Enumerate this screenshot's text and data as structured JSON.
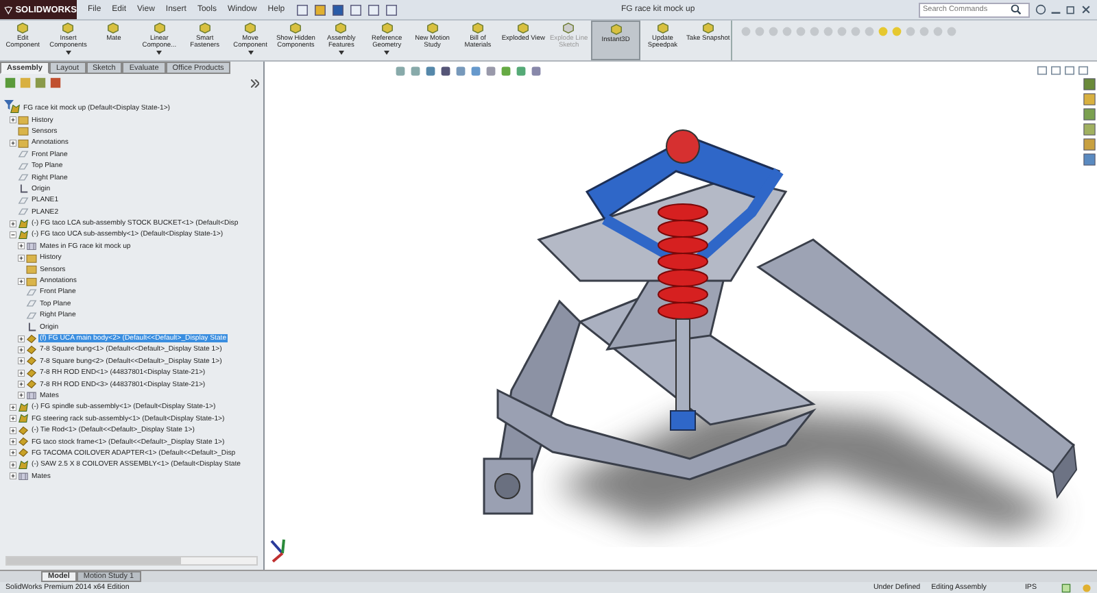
{
  "app": {
    "logo": "SOLIDWORKS",
    "menus": [
      "File",
      "Edit",
      "View",
      "Insert",
      "Tools",
      "Window",
      "Help"
    ],
    "title": "FG race kit mock up",
    "search": {
      "placeholder": "Search Commands"
    }
  },
  "commands": [
    {
      "label": "Edit Component",
      "menu": false,
      "disabled": false,
      "selected": false
    },
    {
      "label": "Insert Components",
      "menu": true,
      "disabled": false,
      "selected": false
    },
    {
      "label": "Mate",
      "menu": false,
      "disabled": false,
      "selected": false
    },
    {
      "label": "Linear Compone...",
      "menu": true,
      "disabled": false,
      "selected": false
    },
    {
      "label": "Smart Fasteners",
      "menu": false,
      "disabled": false,
      "selected": false
    },
    {
      "label": "Move Component",
      "menu": true,
      "disabled": false,
      "selected": false
    },
    {
      "label": "Show Hidden Components",
      "menu": false,
      "disabled": false,
      "selected": false
    },
    {
      "label": "Assembly Features",
      "menu": true,
      "disabled": false,
      "selected": false
    },
    {
      "label": "Reference Geometry",
      "menu": true,
      "disabled": false,
      "selected": false
    },
    {
      "label": "New Motion Study",
      "menu": false,
      "disabled": false,
      "selected": false
    },
    {
      "label": "Bill of Materials",
      "menu": false,
      "disabled": false,
      "selected": false
    },
    {
      "label": "Exploded View",
      "menu": false,
      "disabled": false,
      "selected": false
    },
    {
      "label": "Explode Line Sketch",
      "menu": false,
      "disabled": true,
      "selected": false
    },
    {
      "label": "Instant3D",
      "menu": false,
      "disabled": false,
      "selected": true
    },
    {
      "label": "Update Speedpak",
      "menu": false,
      "disabled": false,
      "selected": false
    },
    {
      "label": "Take Snapshot",
      "menu": false,
      "disabled": false,
      "selected": false
    }
  ],
  "tabs": [
    {
      "label": "Assembly",
      "selected": true
    },
    {
      "label": "Layout",
      "selected": false
    },
    {
      "label": "Sketch",
      "selected": false
    },
    {
      "label": "Evaluate",
      "selected": false
    },
    {
      "label": "Office Products",
      "selected": false
    }
  ],
  "tree": {
    "label": "FG race kit mock up  (Default<Display State-1>)",
    "kind": "assembly",
    "selected": false,
    "children": [
      {
        "label": "History",
        "kind": "folder",
        "expanded": false,
        "selected": false
      },
      {
        "label": "Sensors",
        "kind": "folder",
        "selected": false
      },
      {
        "label": "Annotations",
        "kind": "annotation",
        "expanded": false,
        "selected": false
      },
      {
        "label": "Front Plane",
        "kind": "plane",
        "selected": false
      },
      {
        "label": "Top Plane",
        "kind": "plane",
        "selected": false
      },
      {
        "label": "Right Plane",
        "kind": "plane",
        "selected": false
      },
      {
        "label": "Origin",
        "kind": "origin",
        "selected": false
      },
      {
        "label": "PLANE1",
        "kind": "plane",
        "selected": false
      },
      {
        "label": "PLANE2",
        "kind": "plane",
        "selected": false
      },
      {
        "label": "(-) FG taco LCA sub-assembly STOCK BUCKET<1> (Default<Disp",
        "kind": "assembly",
        "expanded": false,
        "selected": false
      },
      {
        "label": "(-) FG taco UCA sub-assembly<1> (Default<Display State-1>)",
        "kind": "assembly",
        "expanded": true,
        "selected": false,
        "children": [
          {
            "label": "Mates in FG race kit mock up",
            "kind": "mates",
            "expanded": false,
            "selected": false
          },
          {
            "label": "History",
            "kind": "folder",
            "expanded": false,
            "selected": false
          },
          {
            "label": "Sensors",
            "kind": "folder",
            "selected": false
          },
          {
            "label": "Annotations",
            "kind": "annotation",
            "expanded": false,
            "selected": false
          },
          {
            "label": "Front Plane",
            "kind": "plane",
            "selected": false
          },
          {
            "label": "Top Plane",
            "kind": "plane",
            "selected": false
          },
          {
            "label": "Right Plane",
            "kind": "plane",
            "selected": false
          },
          {
            "label": "Origin",
            "kind": "origin",
            "selected": false
          },
          {
            "label": "(f) FG UCA main body<2> (Default<<Default>_Display State",
            "kind": "part",
            "expanded": false,
            "selected": true
          },
          {
            "label": "7-8 Square bung<1> (Default<<Default>_Display State 1>)",
            "kind": "part",
            "expanded": false,
            "selected": false
          },
          {
            "label": "7-8 Square bung<2> (Default<<Default>_Display State 1>)",
            "kind": "part",
            "expanded": false,
            "selected": false
          },
          {
            "label": "7-8 RH ROD END<1> (44837801<Display State-21>)",
            "kind": "part",
            "expanded": false,
            "selected": false
          },
          {
            "label": "7-8 RH ROD END<3> (44837801<Display State-21>)",
            "kind": "part",
            "expanded": false,
            "selected": false
          },
          {
            "label": "Mates",
            "kind": "mates",
            "expanded": false,
            "selected": false
          }
        ]
      },
      {
        "label": "(-) FG spindle sub-assembly<1> (Default<Display State-1>)",
        "kind": "assembly",
        "expanded": false,
        "selected": false
      },
      {
        "label": "FG steering rack sub-assembly<1> (Default<Display State-1>)",
        "kind": "assembly",
        "expanded": false,
        "selected": false
      },
      {
        "label": "(-) Tie Rod<1> (Default<<Default>_Display State 1>)",
        "kind": "part",
        "expanded": false,
        "selected": false
      },
      {
        "label": "FG taco stock frame<1> (Default<<Default>_Display State 1>)",
        "kind": "part",
        "expanded": false,
        "selected": false
      },
      {
        "label": "FG TACOMA COILOVER ADAPTER<1> (Default<<Default>_Disp",
        "kind": "part",
        "expanded": false,
        "selected": false
      },
      {
        "label": "(-) SAW 2.5 X 8 COILOVER ASSEMBLY<1> (Default<Display State",
        "kind": "assembly",
        "expanded": false,
        "selected": false
      },
      {
        "label": "Mates",
        "kind": "mates",
        "expanded": false,
        "selected": false
      }
    ]
  },
  "model_tabs": [
    {
      "label": "Model",
      "selected": true
    },
    {
      "label": "Motion Study 1",
      "selected": false
    }
  ],
  "status_bar": {
    "product": "SolidWorks Premium 2014 x64 Edition",
    "state": "Under Defined",
    "mode": "Editing Assembly",
    "units": "IPS"
  }
}
